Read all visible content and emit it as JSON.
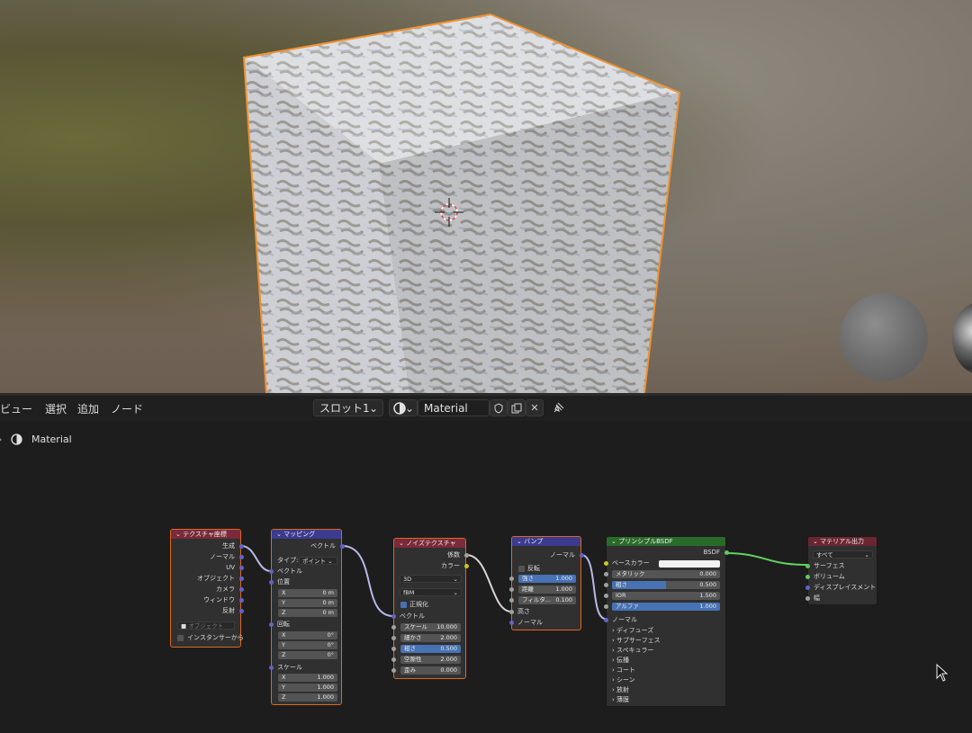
{
  "menu": {
    "view": "ビュー",
    "select": "選択",
    "add": "追加",
    "node": "ノード"
  },
  "header": {
    "slot": "スロット1",
    "material_name": "Material"
  },
  "breadcrumb": {
    "material": "Material"
  },
  "nodes": {
    "texcoord": {
      "title": "テクスチャ座標",
      "outputs": [
        "生成",
        "ノーマル",
        "UV",
        "オブジェクト",
        "カメラ",
        "ウィンドウ",
        "反射"
      ],
      "object_placeholder": "オブジェクト",
      "from_instancer": "インスタンサーから"
    },
    "mapping": {
      "title": "マッピング",
      "output": "ベクトル",
      "type_label": "タイプ:",
      "type_value": "ポイント",
      "vector": "ベクトル",
      "location": "位置",
      "loc": [
        {
          "k": "X",
          "v": "0 m"
        },
        {
          "k": "Y",
          "v": "0 m"
        },
        {
          "k": "Z",
          "v": "0 m"
        }
      ],
      "rotation": "回転",
      "rot": [
        {
          "k": "X",
          "v": "0°"
        },
        {
          "k": "Y",
          "v": "0°"
        },
        {
          "k": "Z",
          "v": "0°"
        }
      ],
      "scale": "スケール",
      "scl": [
        {
          "k": "X",
          "v": "1.000"
        },
        {
          "k": "Y",
          "v": "1.000"
        },
        {
          "k": "Z",
          "v": "1.000"
        }
      ]
    },
    "noise": {
      "title": "ノイズテクスチャ",
      "out_fac": "係数",
      "out_color": "カラー",
      "dim": "3D",
      "type": "fBM",
      "normalize": "正規化",
      "vector": "ベクトル",
      "params": [
        {
          "k": "スケール",
          "v": "10.000",
          "blue": false
        },
        {
          "k": "細かさ",
          "v": "2.000",
          "blue": false
        },
        {
          "k": "粗さ",
          "v": "0.500",
          "blue": true
        },
        {
          "k": "空隙性",
          "v": "2.000",
          "blue": false
        },
        {
          "k": "歪み",
          "v": "0.000",
          "blue": false
        }
      ]
    },
    "bump": {
      "title": "バンプ",
      "out_normal": "ノーマル",
      "invert": "反転",
      "params": [
        {
          "k": "強さ",
          "v": "1.000",
          "blue": true
        },
        {
          "k": "距離",
          "v": "1.000",
          "blue": false
        },
        {
          "k": "フィルタ...",
          "v": "0.100",
          "blue": false
        }
      ],
      "height": "高さ",
      "normal": "ノーマル"
    },
    "bsdf": {
      "title": "プリンシプルBSDF",
      "out": "BSDF",
      "base_color": "ベースカラー",
      "params": [
        {
          "k": "メタリック",
          "v": "0.000",
          "fill": 0
        },
        {
          "k": "粗さ",
          "v": "0.500",
          "fill": 0.5
        },
        {
          "k": "IOR",
          "v": "1.500",
          "fill": 0
        },
        {
          "k": "アルファ",
          "v": "1.000",
          "fill": 1
        }
      ],
      "normal": "ノーマル",
      "panels": [
        "ディフューズ",
        "サブサーフェス",
        "スペキュラー",
        "伝播",
        "コート",
        "シーン",
        "放射",
        "薄膜"
      ]
    },
    "output": {
      "title": "マテリアル出力",
      "target": "すべて",
      "inputs": [
        "サーフェス",
        "ボリューム",
        "ディスプレイスメント",
        "幅"
      ]
    }
  },
  "colors": {
    "selection_orange": "#e0661f",
    "texture_header": "#7a2a3a",
    "vector_header": "#3b3b8f",
    "shader_header": "#2a6b2a",
    "output_header": "#6a2630",
    "socket_vector": "#6363c7",
    "socket_color": "#c7c729",
    "socket_float": "#a1a1a1",
    "socket_shader": "#63c763",
    "field_blue": "#4772b3"
  }
}
